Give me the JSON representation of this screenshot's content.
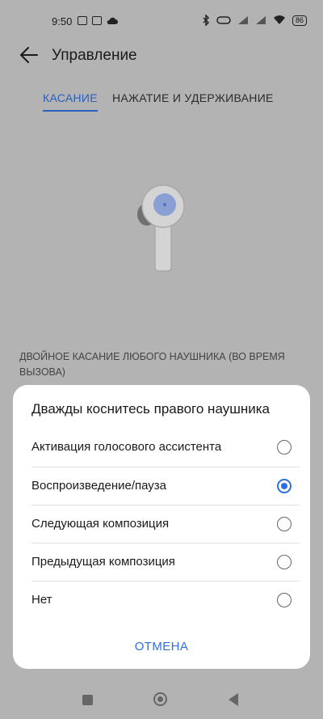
{
  "status_bar": {
    "time": "9:50",
    "battery": "86"
  },
  "toolbar": {
    "title": "Управление"
  },
  "tabs": [
    {
      "label": "КАСАНИЕ",
      "active": true
    },
    {
      "label": "НАЖАТИЕ И УДЕРЖИВАНИЕ",
      "active": false
    }
  ],
  "section": {
    "label": "ДВОЙНОЕ КАСАНИЕ ЛЮБОГО НАУШНИКА (ВО ВРЕМЯ ВЫЗОВА)"
  },
  "dialog": {
    "title": "Дважды коснитесь правого наушника",
    "options": [
      {
        "label": "Активация голосового ассистента",
        "selected": false
      },
      {
        "label": "Воспроизведение/пауза",
        "selected": true
      },
      {
        "label": "Следующая композиция",
        "selected": false
      },
      {
        "label": "Предыдущая композиция",
        "selected": false
      },
      {
        "label": "Нет",
        "selected": false
      }
    ],
    "cancel_label": "ОТМЕНА"
  },
  "colors": {
    "accent": "#2f6ee0",
    "scrim": "#b3b3b3"
  }
}
